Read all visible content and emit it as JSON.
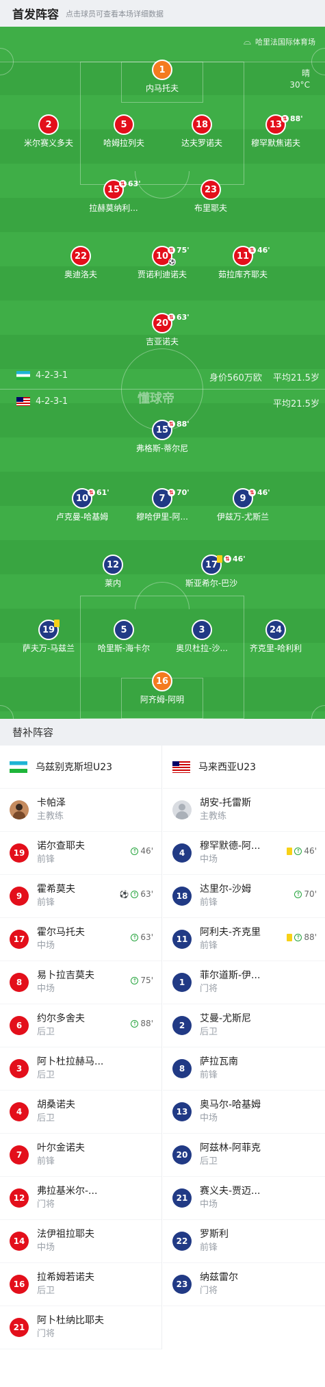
{
  "header": {
    "title": "首发阵容",
    "subtitle": "点击球员可查看本场详细数据"
  },
  "venue": {
    "stadium": "哈里法国际体育场",
    "weather": "晴",
    "temperature": "30°C"
  },
  "watermark": "懂球帝",
  "home": {
    "formation": "4-2-3-1",
    "value": "身价560万欧",
    "age": "平均21.5岁"
  },
  "away": {
    "formation": "4-2-3-1",
    "age": "平均21.5岁"
  },
  "home_players": [
    {
      "num": "1",
      "name": "内马托夫",
      "kit": "o"
    },
    {
      "num": "2",
      "name": "米尔赛义多夫",
      "kit": "r"
    },
    {
      "num": "5",
      "name": "哈姆拉列夫",
      "kit": "r"
    },
    {
      "num": "18",
      "name": "达夫罗诺夫",
      "kit": "r"
    },
    {
      "num": "13",
      "name": "穆罕默焦诺夫",
      "kit": "r",
      "sub": "88'"
    },
    {
      "num": "15",
      "name": "拉赫莫纳利...",
      "kit": "r",
      "sub": "63'"
    },
    {
      "num": "23",
      "name": "布里耶夫",
      "kit": "r"
    },
    {
      "num": "22",
      "name": "奥迪洛夫",
      "kit": "r"
    },
    {
      "num": "10",
      "name": "贾诺利迪诺夫",
      "kit": "r",
      "sub": "75'",
      "goal": true
    },
    {
      "num": "11",
      "name": "茹拉库齐耶夫",
      "kit": "r",
      "sub": "46'"
    },
    {
      "num": "20",
      "name": "吉亚诺夫",
      "kit": "r",
      "sub": "63'"
    }
  ],
  "away_players": [
    {
      "num": "15",
      "name": "弗格斯-蒂尔尼",
      "kit": "b",
      "sub": "88'"
    },
    {
      "num": "10",
      "name": "卢克曼-哈基姆",
      "kit": "b",
      "sub": "61'"
    },
    {
      "num": "7",
      "name": "穆哈伊里-阿...",
      "kit": "b",
      "sub": "70'"
    },
    {
      "num": "9",
      "name": "伊兹万-尤斯兰",
      "kit": "b",
      "sub": "46'"
    },
    {
      "num": "12",
      "name": "莱内",
      "kit": "b"
    },
    {
      "num": "17",
      "name": "斯亚希尔-巴沙",
      "kit": "b",
      "sub": "46'",
      "yellow": true
    },
    {
      "num": "19",
      "name": "萨夫万-马兹兰",
      "kit": "b",
      "yellow": true
    },
    {
      "num": "5",
      "name": "哈里斯-海卡尔",
      "kit": "b"
    },
    {
      "num": "3",
      "name": "奥贝杜拉-沙...",
      "kit": "b"
    },
    {
      "num": "24",
      "name": "齐克里-哈利利",
      "kit": "b"
    },
    {
      "num": "16",
      "name": "阿齐姆-阿明",
      "kit": "o"
    }
  ],
  "subs": {
    "title": "替补阵容",
    "left": {
      "team": "乌兹别克斯坦U23",
      "coach": {
        "name": "卡帕泽",
        "role": "主教练"
      },
      "players": [
        {
          "num": "19",
          "name": "诺尔查耶夫",
          "pos": "前锋",
          "in": "46'"
        },
        {
          "num": "9",
          "name": "霍希莫夫",
          "pos": "前锋",
          "in": "63'",
          "goal": true
        },
        {
          "num": "17",
          "name": "霍尔马托夫",
          "pos": "中场",
          "in": "63'"
        },
        {
          "num": "8",
          "name": "易卜拉吉莫夫",
          "pos": "中场",
          "in": "75'"
        },
        {
          "num": "6",
          "name": "约尔多舍夫",
          "pos": "后卫",
          "in": "88'"
        },
        {
          "num": "3",
          "name": "阿卜杜拉赫马...",
          "pos": "后卫"
        },
        {
          "num": "4",
          "name": "胡桑诺夫",
          "pos": "后卫"
        },
        {
          "num": "7",
          "name": "叶尔金诺夫",
          "pos": "前锋"
        },
        {
          "num": "12",
          "name": "弗拉基米尔-...",
          "pos": "门将"
        },
        {
          "num": "14",
          "name": "法伊祖拉耶夫",
          "pos": "中场"
        },
        {
          "num": "16",
          "name": "拉希姆若诺夫",
          "pos": "后卫"
        },
        {
          "num": "21",
          "name": "阿卜杜纳比耶夫",
          "pos": "门将"
        }
      ]
    },
    "right": {
      "team": "马来西亚U23",
      "coach": {
        "name": "胡安-托雷斯",
        "role": "主教练"
      },
      "players": [
        {
          "num": "4",
          "name": "穆罕默德-阿...",
          "pos": "中场",
          "in": "46'",
          "yellow": true
        },
        {
          "num": "18",
          "name": "达里尔-沙姆",
          "pos": "前锋",
          "in": "70'"
        },
        {
          "num": "11",
          "name": "阿利夫-齐克里",
          "pos": "前锋",
          "in": "88'",
          "yellow": true
        },
        {
          "num": "1",
          "name": "菲尔道斯-伊...",
          "pos": "门将"
        },
        {
          "num": "2",
          "name": "艾曼-尤斯尼",
          "pos": "后卫"
        },
        {
          "num": "8",
          "name": "萨拉瓦南",
          "pos": "前锋"
        },
        {
          "num": "13",
          "name": "奥马尔-哈基姆",
          "pos": "中场"
        },
        {
          "num": "20",
          "name": "阿兹林-阿菲克",
          "pos": "后卫"
        },
        {
          "num": "21",
          "name": "赛义夫-贾迈...",
          "pos": "中场"
        },
        {
          "num": "22",
          "name": "罗斯利",
          "pos": "前锋"
        },
        {
          "num": "23",
          "name": "纳兹雷尔",
          "pos": "门将"
        }
      ]
    }
  }
}
